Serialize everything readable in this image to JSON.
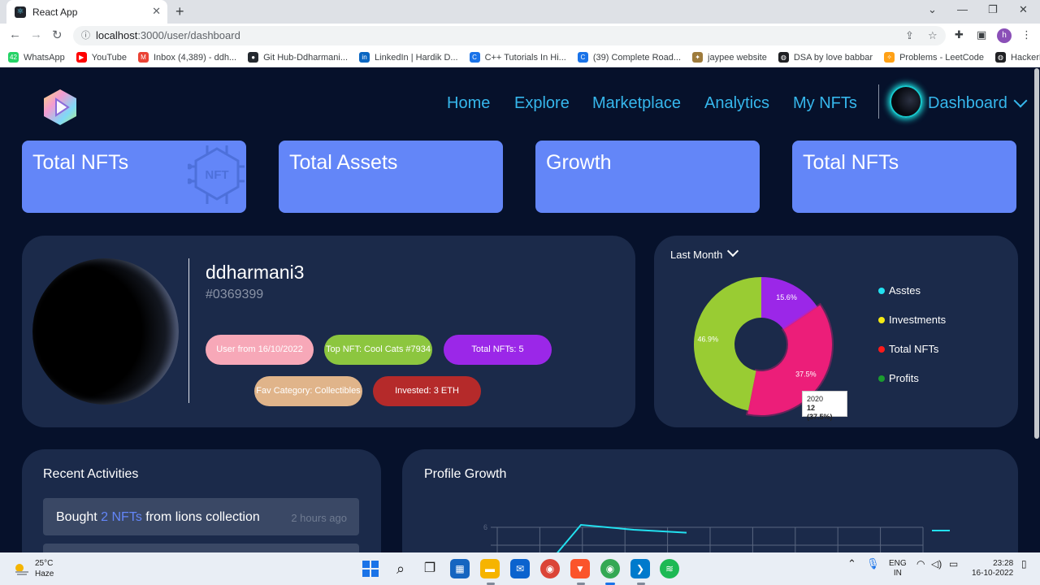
{
  "browser": {
    "tab_title": "React App",
    "tab_close": "✕",
    "new_tab": "+",
    "url_host": "localhost",
    "url_path": ":3000/user/dashboard",
    "window_controls": [
      "⌄",
      "—",
      "❐",
      "✕"
    ],
    "profile_initial": "h",
    "bookmarks": [
      {
        "label": "WhatsApp",
        "color": "#25d366",
        "icon": "whatsapp-icon",
        "glyph": "42"
      },
      {
        "label": "YouTube",
        "color": "#ff0000",
        "icon": "youtube-icon",
        "glyph": "▶"
      },
      {
        "label": "Inbox (4,389) - ddh...",
        "color": "#ea4335",
        "icon": "gmail-icon",
        "glyph": "M"
      },
      {
        "label": "Git Hub-Ddharmani...",
        "color": "#24292f",
        "icon": "github-icon",
        "glyph": "●"
      },
      {
        "label": "LinkedIn | Hardik D...",
        "color": "#0a66c2",
        "icon": "linkedin-icon",
        "glyph": "in"
      },
      {
        "label": "C++ Tutorials In Hi...",
        "color": "#1a73e8",
        "icon": "web-icon",
        "glyph": "C"
      },
      {
        "label": "(39) Complete Road...",
        "color": "#1a73e8",
        "icon": "web-icon",
        "glyph": "C"
      },
      {
        "label": "jaypee website",
        "color": "#9e7b3c",
        "icon": "jaypee-icon",
        "glyph": "✦"
      },
      {
        "label": "DSA by love babbar",
        "color": "#202124",
        "icon": "globe-icon",
        "glyph": "◍"
      },
      {
        "label": "Problems - LeetCode",
        "color": "#ffa116",
        "icon": "leetcode-icon",
        "glyph": "✧"
      },
      {
        "label": "HackerRank",
        "color": "#202124",
        "icon": "globe-icon",
        "glyph": "◍"
      }
    ],
    "bookmarks_more": "»"
  },
  "nav": {
    "items": [
      "Home",
      "Explore",
      "Marketplace",
      "Analytics",
      "My NFTs"
    ],
    "user_menu": "Dashboard"
  },
  "stats": [
    "Total NFTs",
    "Total Assets",
    "Growth",
    "Total NFTs"
  ],
  "profile": {
    "username": "ddharmani3",
    "user_id": "#0369399",
    "pills": [
      {
        "label": "User from 16/10/2022",
        "color": "#f7a8b8"
      },
      {
        "label": "Top NFT: Cool Cats #7934",
        "color": "#8cc63f"
      },
      {
        "label": "Total NFTs: 5",
        "color": "#9b27e8"
      },
      {
        "label": "Fav Category: Collectibles",
        "color": "#e0b48a"
      },
      {
        "label": "Invested: 3 ETH",
        "color": "#b52a2a"
      }
    ]
  },
  "chart_data": [
    {
      "type": "pie",
      "variant": "donut",
      "period": "Last Month",
      "slices": [
        {
          "label": "15.6%",
          "value": 15.6,
          "color": "#9b27e8"
        },
        {
          "label": "37.5%",
          "value": 37.5,
          "color": "#ec1e79"
        },
        {
          "label": "46.9%",
          "value": 46.9,
          "color": "#99cc33"
        }
      ],
      "legend": [
        {
          "name": "Asstes",
          "color": "#22e1f0"
        },
        {
          "name": "Investments",
          "color": "#f5ea14"
        },
        {
          "name": "Total NFTs",
          "color": "#ff1a1a"
        },
        {
          "name": "Profits",
          "color": "#1b9b2f"
        }
      ],
      "tooltip": {
        "title": "2020",
        "value": "12 (37.5%)"
      }
    },
    {
      "type": "line",
      "title": "Profile Growth",
      "y_tick_visible": "6",
      "series": [
        {
          "color": "#22e1f0",
          "points": [
            [
              0,
              0
            ],
            [
              1,
              6
            ],
            [
              2,
              5
            ],
            [
              3,
              4.4
            ]
          ]
        }
      ]
    }
  ],
  "activities": {
    "title": "Recent Activities",
    "items": [
      {
        "prefix": "Bought ",
        "highlight": "2 NFTs",
        "suffix": " from lions collection",
        "time": "2 hours ago"
      }
    ]
  },
  "taskbar": {
    "temp": "25°C",
    "condition": "Haze",
    "lang": "ENG",
    "region": "IN",
    "time": "23:28",
    "date": "16-10-2022"
  }
}
